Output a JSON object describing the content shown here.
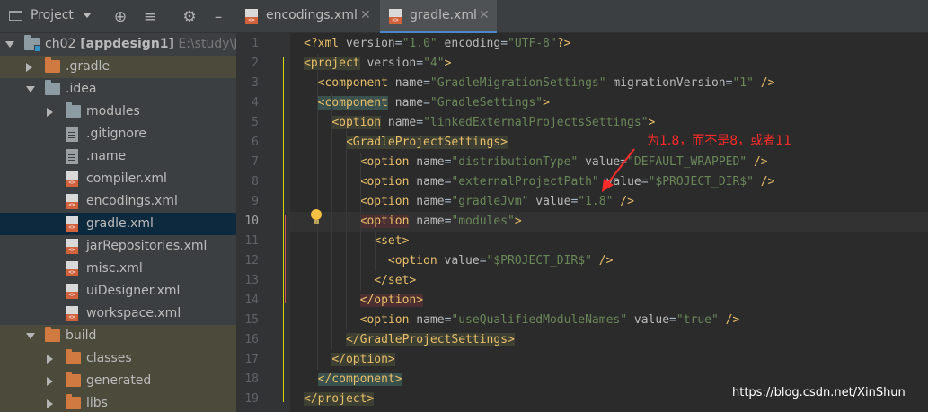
{
  "panel": {
    "title": "Project",
    "icons": [
      "project-view-icon",
      "target-icon",
      "collapse-icon",
      "gear-icon",
      "minimize-icon"
    ]
  },
  "tree": [
    {
      "label": "ch02",
      "module": "[appdesign1]",
      "path": "E:\\study\\JAV",
      "kind": "module",
      "arrow": "down",
      "indent": 0
    },
    {
      "label": ".gradle",
      "kind": "folder-orange",
      "arrow": "right",
      "indent": 1,
      "highlight": "brown"
    },
    {
      "label": ".idea",
      "kind": "folder",
      "arrow": "down",
      "indent": 1
    },
    {
      "label": "modules",
      "kind": "folder",
      "arrow": "right",
      "indent": 2
    },
    {
      "label": ".gitignore",
      "kind": "file",
      "indent": 2
    },
    {
      "label": ".name",
      "kind": "file",
      "indent": 2
    },
    {
      "label": "compiler.xml",
      "kind": "xml",
      "indent": 2
    },
    {
      "label": "encodings.xml",
      "kind": "xml",
      "indent": 2
    },
    {
      "label": "gradle.xml",
      "kind": "xml",
      "indent": 2,
      "highlight": "selected"
    },
    {
      "label": "jarRepositories.xml",
      "kind": "xml",
      "indent": 2
    },
    {
      "label": "misc.xml",
      "kind": "xml",
      "indent": 2
    },
    {
      "label": "uiDesigner.xml",
      "kind": "xml",
      "indent": 2
    },
    {
      "label": "workspace.xml",
      "kind": "xml",
      "indent": 2
    },
    {
      "label": "build",
      "kind": "folder-orange",
      "arrow": "down",
      "indent": 1,
      "highlight": "brown"
    },
    {
      "label": "classes",
      "kind": "folder-orange",
      "arrow": "right",
      "indent": 2,
      "highlight": "brown"
    },
    {
      "label": "generated",
      "kind": "folder-orange",
      "arrow": "right",
      "indent": 2,
      "highlight": "brown"
    },
    {
      "label": "libs",
      "kind": "folder-orange",
      "arrow": "right",
      "indent": 2,
      "highlight": "brown"
    }
  ],
  "tabs": [
    {
      "label": "encodings.xml",
      "active": false
    },
    {
      "label": "gradle.xml",
      "active": true
    }
  ],
  "code": {
    "current_line": 10,
    "lines": [
      [
        [
          "pi",
          "<?xml "
        ],
        [
          "at",
          "version"
        ],
        [
          "",
          "="
        ],
        [
          "av",
          "\"1.0\""
        ],
        [
          "at",
          " encoding"
        ],
        [
          "",
          "="
        ],
        [
          "av",
          "\"UTF-8\""
        ],
        [
          "pi",
          "?>"
        ]
      ],
      [
        [
          "tg",
          "<project"
        ],
        [
          "at",
          " version"
        ],
        [
          "",
          "="
        ],
        [
          "av",
          "\"4\""
        ],
        [
          "tg",
          ">"
        ]
      ],
      [
        [
          "",
          "  "
        ],
        [
          "tg",
          "<component"
        ],
        [
          "at",
          " name"
        ],
        [
          "",
          "="
        ],
        [
          "av",
          "\"GradleMigrationSettings\""
        ],
        [
          "at",
          " migrationVersion"
        ],
        [
          "",
          "="
        ],
        [
          "av",
          "\"1\""
        ],
        [
          "tg",
          " />"
        ]
      ],
      [
        [
          "",
          "  "
        ],
        [
          "tg",
          "<component"
        ],
        [
          "at",
          " name"
        ],
        [
          "",
          "="
        ],
        [
          "av",
          "\"GradleSettings\""
        ],
        [
          "tg",
          ">"
        ]
      ],
      [
        [
          "",
          "    "
        ],
        [
          "tg",
          "<option"
        ],
        [
          "at",
          " name"
        ],
        [
          "",
          "="
        ],
        [
          "av",
          "\"linkedExternalProjectsSettings\""
        ],
        [
          "tg",
          ">"
        ]
      ],
      [
        [
          "",
          "      "
        ],
        [
          "tg",
          "<GradleProjectSettings>"
        ]
      ],
      [
        [
          "",
          "        "
        ],
        [
          "tg",
          "<option"
        ],
        [
          "at",
          " name"
        ],
        [
          "",
          "="
        ],
        [
          "av",
          "\"distributionType\""
        ],
        [
          "at",
          " value"
        ],
        [
          "",
          "="
        ],
        [
          "av",
          "\"DEFAULT_WRAPPED\""
        ],
        [
          "tg",
          " />"
        ]
      ],
      [
        [
          "",
          "        "
        ],
        [
          "tg",
          "<option"
        ],
        [
          "at",
          " name"
        ],
        [
          "",
          "="
        ],
        [
          "av",
          "\"externalProjectPath\""
        ],
        [
          "at",
          " value"
        ],
        [
          "",
          "="
        ],
        [
          "av",
          "\"$PROJECT_DIR$\""
        ],
        [
          "tg",
          " />"
        ]
      ],
      [
        [
          "",
          "        "
        ],
        [
          "tg",
          "<option"
        ],
        [
          "at",
          " name"
        ],
        [
          "",
          "="
        ],
        [
          "av",
          "\"gradleJvm\""
        ],
        [
          "at",
          " value"
        ],
        [
          "",
          "="
        ],
        [
          "av",
          "\"1.8\""
        ],
        [
          "tg",
          " />"
        ]
      ],
      [
        [
          "",
          "        "
        ],
        [
          "tg",
          "<option"
        ],
        [
          "at",
          " name"
        ],
        [
          "",
          "="
        ],
        [
          "av",
          "\"modules\""
        ],
        [
          "tg",
          ">"
        ]
      ],
      [
        [
          "",
          "          "
        ],
        [
          "tg",
          "<set>"
        ]
      ],
      [
        [
          "",
          "            "
        ],
        [
          "tg",
          "<option"
        ],
        [
          "at",
          " value"
        ],
        [
          "",
          "="
        ],
        [
          "av",
          "\"$PROJECT_DIR$\""
        ],
        [
          "tg",
          " />"
        ]
      ],
      [
        [
          "",
          "          "
        ],
        [
          "tg",
          "</set>"
        ]
      ],
      [
        [
          "",
          "        "
        ],
        [
          "tg",
          "</option>"
        ]
      ],
      [
        [
          "",
          "        "
        ],
        [
          "tg",
          "<option"
        ],
        [
          "at",
          " name"
        ],
        [
          "",
          "="
        ],
        [
          "av",
          "\"useQualifiedModuleNames\""
        ],
        [
          "at",
          " value"
        ],
        [
          "",
          "="
        ],
        [
          "av",
          "\"true\""
        ],
        [
          "tg",
          " />"
        ]
      ],
      [
        [
          "",
          "      "
        ],
        [
          "tg",
          "</GradleProjectSettings>"
        ]
      ],
      [
        [
          "",
          "    "
        ],
        [
          "tg",
          "</option>"
        ]
      ],
      [
        [
          "",
          "  "
        ],
        [
          "tg",
          "</component>"
        ]
      ],
      [
        [
          "tg",
          "</project>"
        ]
      ]
    ]
  },
  "annotation": "为1.8，而不是8，或者11",
  "watermark": "https://blog.csdn.net/XinShun",
  "colors": {
    "tag": "#e8bf6a",
    "attr": "#bababa",
    "value": "#6a8759",
    "annotation": "#ff2b2b",
    "selection": "#0d293e"
  }
}
